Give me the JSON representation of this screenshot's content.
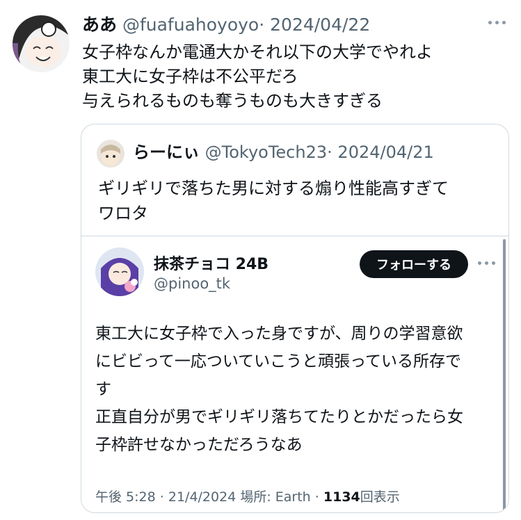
{
  "tweet": {
    "name": "ああ",
    "handle": "@fuafuahoyoyo",
    "separator": "·",
    "date": "2024/04/22",
    "more_icon": "ellipsis-icon",
    "lines": [
      "女子枠なんか電通大かそれ以下の大学でやれよ",
      "東工大に女子枠は不公平だろ",
      "与えられるものも奪うものも大きすぎる"
    ]
  },
  "quote": {
    "name": "らーにぃ",
    "handle": "@TokyoTech23",
    "separator": "·",
    "date": "2024/04/21",
    "lines": [
      "ギリギリで落ちた男に対する煽り性能高すぎて",
      "ワロタ"
    ],
    "embed": {
      "name": "抹茶チョコ 24B",
      "handle": "@pinoo_tk",
      "follow_label": "フォローする",
      "lines": [
        "東工大に女子枠で入った身ですが、周りの学習意欲",
        "にビビって一応ついていこうと頑張っている所存で",
        "す",
        "正直自分が男でギリギリ落ちてたりとかだったら女",
        "子枠許せなかっただろうなあ"
      ],
      "meta": {
        "time": "午後 5:28",
        "separator": "·",
        "date": "21/4/2024",
        "location": "場所: Earth",
        "views_count": "1134",
        "views_label": "回表示"
      }
    }
  },
  "colors": {
    "text": "#0f1419",
    "muted": "#536471",
    "border": "#cfd9de",
    "button": "#0f1419"
  }
}
